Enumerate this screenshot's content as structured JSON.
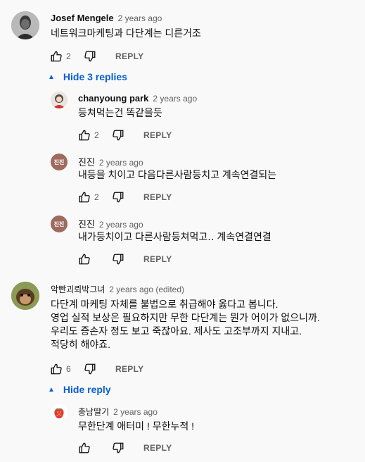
{
  "comments": [
    {
      "author": "Josef Mengele",
      "time": "2 years ago",
      "text": "네트워크마케팅과 다단계는 디른거조",
      "likes": "2",
      "reply": "REPLY",
      "toggle": "Hide 3 replies"
    },
    {
      "author": "악빤괴뢰박그녀",
      "time": "2 years ago (edited)",
      "text": "다단계 마케팅 자체를 불법으로 취급해야 옳다고 봅니다.\n영업 실적 보상은 필요하지만 무한 다단계는 뭔가 어이가 없으니까.\n우리도 증손자 정도 보고 죽잖아요. 제사도 고조부까지 지내고.\n적당히 해야죠.",
      "likes": "6",
      "reply": "REPLY",
      "toggle": "Hide reply"
    }
  ],
  "replies": [
    {
      "author": "chanyoung park",
      "time": "2 years ago",
      "text": "등쳐먹는건 똑같을듯",
      "likes": "2",
      "reply": "REPLY"
    },
    {
      "author": "진진",
      "initial": "진진",
      "time": "2 years ago",
      "text": "내등을 치이고 다음다른사람등치고 계속연결되는",
      "likes": "2",
      "reply": "REPLY"
    },
    {
      "author": "진진",
      "initial": "진진",
      "time": "2 years ago",
      "text": "내가등치이고  다른사람등쳐먹고‥ 계속연결연결",
      "likes": "",
      "reply": "REPLY"
    },
    {
      "author": "충남딸기",
      "time": "2 years ago",
      "text": "무한단계 애터미 ! 무한누적 !",
      "likes": "",
      "reply": "REPLY"
    }
  ],
  "colors": {
    "text": "#0f0f0f",
    "secondary": "#606060",
    "link": "#065fd4",
    "initial_avatar": "#9e6b5e"
  },
  "icons": [
    "thumb-up-icon",
    "thumb-down-icon",
    "caret-up-icon",
    "strawberry-icon"
  ]
}
